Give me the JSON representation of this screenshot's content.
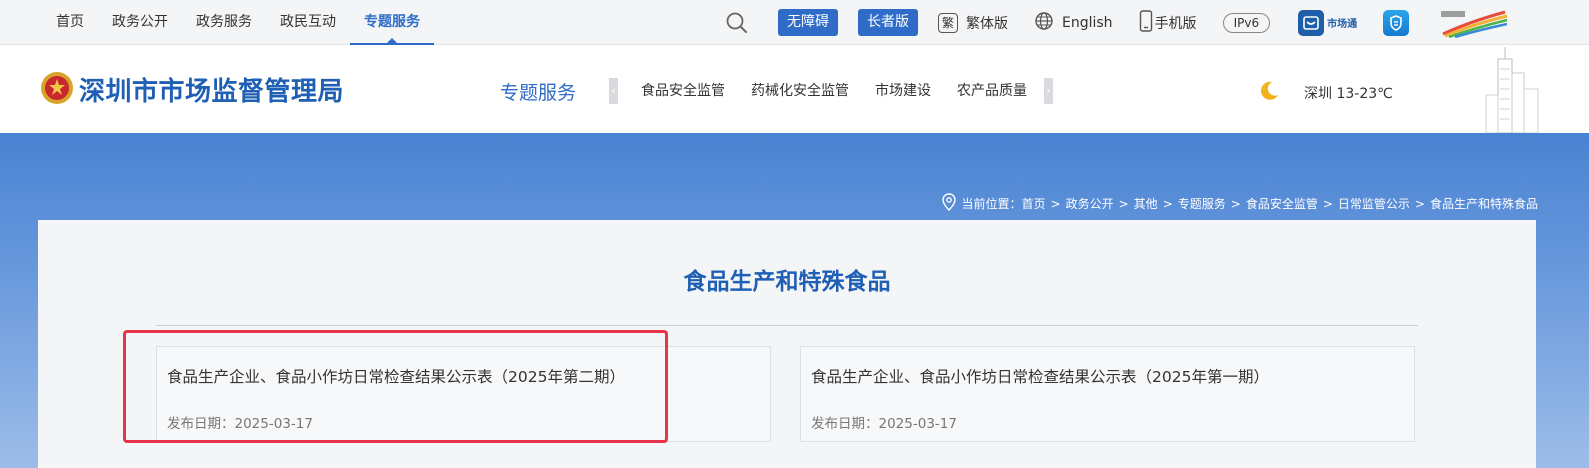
{
  "topnav": {
    "items": [
      {
        "label": "首页"
      },
      {
        "label": "政务公开"
      },
      {
        "label": "政务服务"
      },
      {
        "label": "政民互动"
      },
      {
        "label": "专题服务"
      }
    ],
    "active_index": 4
  },
  "tools": {
    "search_icon": "search-icon",
    "accessible_label": "无障碍",
    "elder_label": "长者版",
    "traditional_label": "繁体版",
    "traditional_glyph": "繁",
    "english_label": "English",
    "mobile_label": "手机版",
    "ipv6_label": "IPv6",
    "app1_label": "市场通"
  },
  "header": {
    "site_name": "深圳市市场监督管理局",
    "section_title": "专题服务",
    "subnav": [
      "食品安全监管",
      "药械化安全监管",
      "市场建设",
      "农产品质量安全"
    ],
    "weather": "深圳 13-23℃"
  },
  "breadcrumb": {
    "label": "当前位置：",
    "items": [
      "首页",
      "政务公开",
      "其他",
      "专题服务",
      "食品安全监管",
      "日常监管公示",
      "食品生产和特殊食品"
    ],
    "separator": ">"
  },
  "content": {
    "title": "食品生产和特殊食品",
    "cards": [
      {
        "title": "食品生产企业、食品小作坊日常检查结果公示表（2025年第二期）",
        "date": "发布日期：2025-03-17"
      },
      {
        "title": "食品生产企业、食品小作坊日常检查结果公示表（2025年第一期）",
        "date": "发布日期：2025-03-17"
      }
    ]
  },
  "colors": {
    "brand": "#2e6cc8",
    "title": "#1f5fb4",
    "highlight": "#e8344a"
  }
}
